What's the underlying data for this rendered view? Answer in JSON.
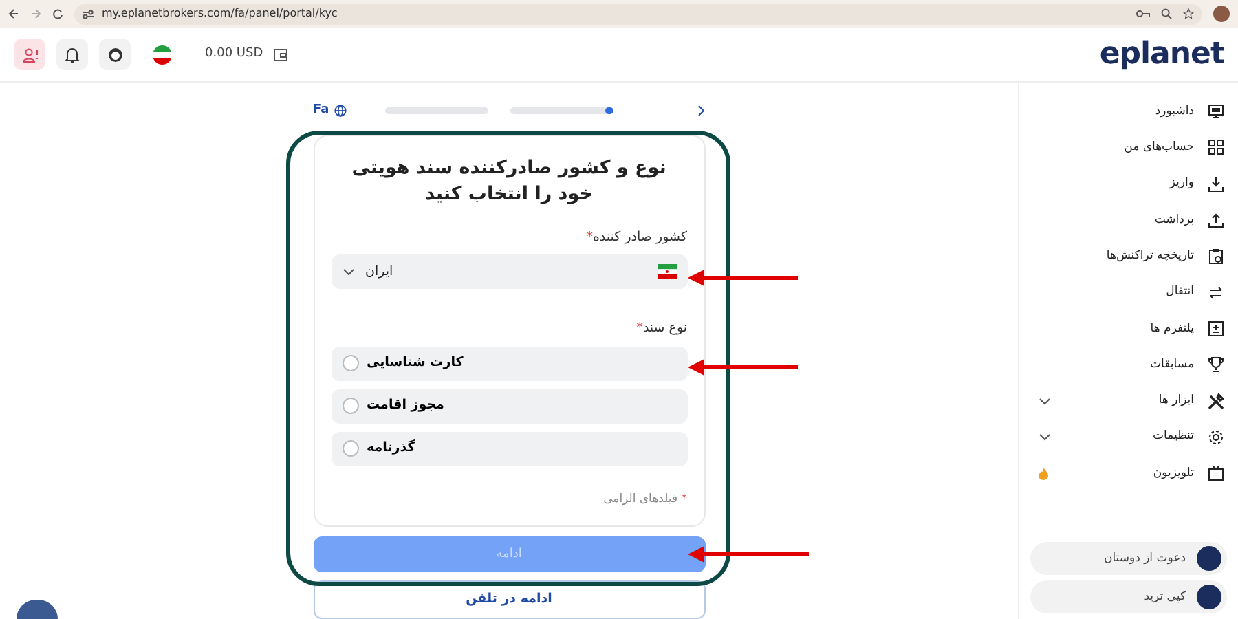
{
  "browser": {
    "url": "my.eplanetbrokers.com/fa/panel/portal/kyc"
  },
  "header": {
    "balance": "0.00 USD",
    "logo": "eplanet"
  },
  "stepper": {
    "language": "Fa",
    "steps": [
      {
        "level": 0
      },
      {
        "level": 0.08
      }
    ]
  },
  "form": {
    "title": "نوع و کشور صادرکننده سند هویتی خود را انتخاب کنید",
    "country": {
      "label": "کشور صادر کننده",
      "required_mark": "*",
      "value": "ایران"
    },
    "document_type": {
      "label": "نوع سند",
      "required_mark": "*",
      "options": [
        {
          "label": "کارت شناسایی",
          "selected": false
        },
        {
          "label": "مجوز اقامت",
          "selected": false
        },
        {
          "label": "گذرنامه",
          "selected": false
        }
      ]
    },
    "required_note": {
      "mark": "*",
      "text": "فیلدهای الزامی"
    },
    "continue_button": {
      "label": "ادامه",
      "disabled": true
    },
    "phone_button": {
      "label": "ادامه در تلفن"
    }
  },
  "sidebar": {
    "items": [
      {
        "label": "داشبورد",
        "kind": "link"
      },
      {
        "label": "حساب‌های من",
        "kind": "link"
      },
      {
        "label": "واریز",
        "kind": "link"
      },
      {
        "label": "برداشت",
        "kind": "link"
      },
      {
        "label": "تاریخچه تراکنش‌ها",
        "kind": "link"
      },
      {
        "label": "انتقال",
        "kind": "link"
      },
      {
        "label": "پلتفرم ها",
        "kind": "link"
      },
      {
        "label": "مسابقات",
        "kind": "link"
      },
      {
        "label": "ابزار ها",
        "kind": "submenu"
      },
      {
        "label": "تنظیمات",
        "kind": "submenu"
      },
      {
        "label": "تلویزیون",
        "kind": "hot"
      }
    ],
    "pills": [
      {
        "label": "دعوت از دوستان"
      },
      {
        "label": "کپی ترید"
      }
    ]
  },
  "annotations": [
    {
      "kind": "frame"
    },
    {
      "kind": "arrow"
    },
    {
      "kind": "arrow"
    },
    {
      "kind": "arrow"
    }
  ]
}
